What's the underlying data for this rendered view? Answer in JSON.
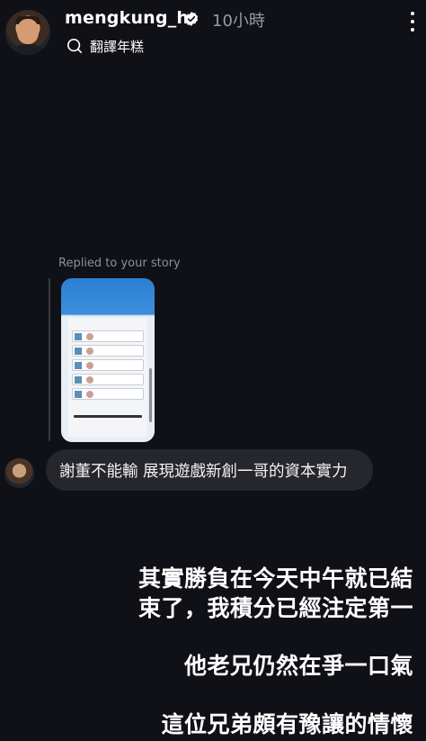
{
  "header": {
    "username": "mengkung_h",
    "time": "10小時",
    "translate_label": "翻譯年糕"
  },
  "reply": {
    "label": "Replied to your story"
  },
  "message": {
    "text": "謝董不能輸 展現遊戲新創一哥的資本實力"
  },
  "story_caption": {
    "line1": "其實勝負在今天中午就已結",
    "line2": "束了，我積分已經注定第一",
    "line3": "他老兄仍然在爭一口氣",
    "line4": "這位兄弟頗有豫讓的情懷"
  },
  "colors": {
    "background": "#101116",
    "bubble": "#26272c",
    "muted_text": "#8e8f94"
  }
}
